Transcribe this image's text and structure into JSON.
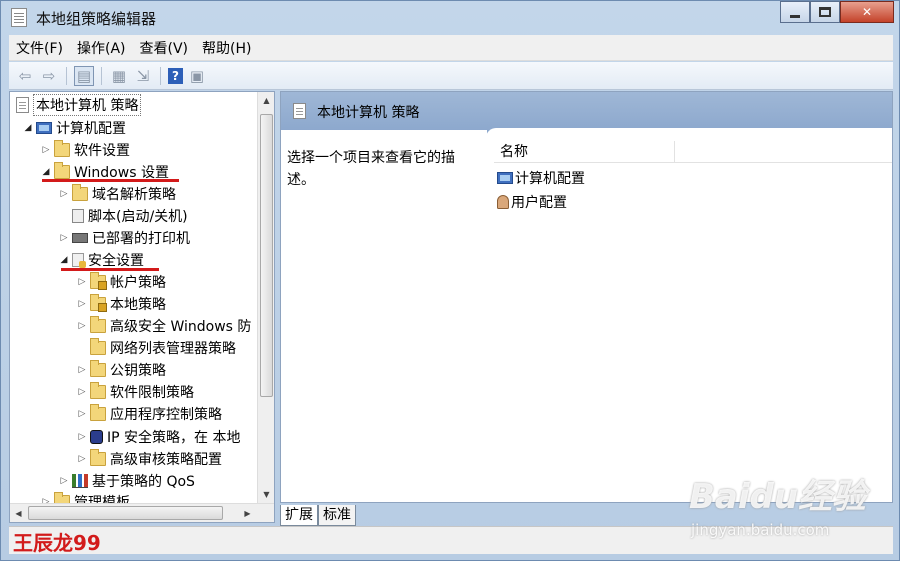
{
  "window": {
    "title": "本地组策略编辑器"
  },
  "menu": [
    "文件(F)",
    "操作(A)",
    "查看(V)",
    "帮助(H)"
  ],
  "tree": {
    "items": [
      {
        "label": "本地计算机 策略"
      },
      {
        "label": "计算机配置"
      },
      {
        "label": "软件设置"
      },
      {
        "label": "Windows 设置"
      },
      {
        "label": "域名解析策略"
      },
      {
        "label": "脚本(启动/关机)"
      },
      {
        "label": "已部署的打印机"
      },
      {
        "label": "安全设置"
      },
      {
        "label": "帐户策略"
      },
      {
        "label": "本地策略"
      },
      {
        "label": "高级安全 Windows 防"
      },
      {
        "label": "网络列表管理器策略"
      },
      {
        "label": "公钥策略"
      },
      {
        "label": "软件限制策略"
      },
      {
        "label": "应用程序控制策略"
      },
      {
        "label": "IP 安全策略，在 本地"
      },
      {
        "label": "高级审核策略配置"
      },
      {
        "label": "基于策略的 QoS"
      },
      {
        "label": "管理模板"
      }
    ]
  },
  "details": {
    "header_title": "本地计算机 策略",
    "description": "选择一个项目来查看它的描述。",
    "column_name": "名称",
    "items": [
      {
        "label": "计算机配置"
      },
      {
        "label": "用户配置"
      }
    ]
  },
  "tabs": [
    "扩展",
    "标准"
  ],
  "overlay": {
    "author": "王辰龙99",
    "watermark": "Baidu经验",
    "watermark_sub": "jingyan.baidu.com"
  }
}
